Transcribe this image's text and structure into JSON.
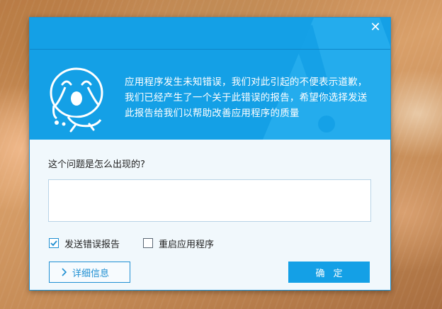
{
  "dialog": {
    "close_glyph": "✕",
    "message": "应用程序发生未知错误，我们对此引起的不便表示道歉，我们已经产生了一个关于此错误的报告，希望你选择发送此报告给我们以帮助改善应用程序的质量",
    "question": "这个问题是怎么出现的?",
    "feedback_value": "",
    "checkboxes": [
      {
        "label": "发送错误报告",
        "checked": true
      },
      {
        "label": "重启应用程序",
        "checked": false
      }
    ],
    "details_label": "详细信息",
    "ok_label": "确定"
  },
  "colors": {
    "header_blue": "#14a0e6",
    "accent_blue": "#1f8fd2",
    "dialog_bg": "#f1f8fc"
  }
}
